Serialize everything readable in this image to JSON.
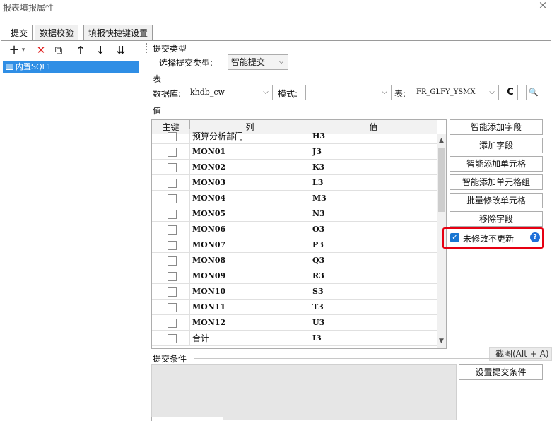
{
  "window": {
    "title": "报表填报属性",
    "close_label": "×"
  },
  "tabs": [
    {
      "label": "提交",
      "active": true
    },
    {
      "label": "数据校验",
      "active": false
    },
    {
      "label": "填报快捷键设置",
      "active": false
    }
  ],
  "toolbar": {
    "add": "+",
    "add_dropdown": "▾",
    "delete": "✕",
    "copy": "⧉",
    "up": "↑",
    "down": "↓",
    "sort": "⇊"
  },
  "tree": {
    "selected_label": "内置SQL1"
  },
  "submit_type": {
    "section_label": "提交类型",
    "field_label": "选择提交类型:",
    "value": "智能提交"
  },
  "table_section": {
    "section_label": "表",
    "db_label": "数据库:",
    "db_value": "khdb_cw",
    "schema_label": "模式:",
    "schema_value": "",
    "table_label": "表:",
    "table_value": "FR_GLFY_YSMX",
    "refresh_icon": "C",
    "preview_icon": "🔍"
  },
  "values": {
    "section_label": "值",
    "headers": {
      "key": "主键",
      "column": "列",
      "value": "值"
    },
    "rows": [
      {
        "column": "预算分析部门",
        "value": "H3",
        "plain": true
      },
      {
        "column": "MON01",
        "value": "J3",
        "plain": false
      },
      {
        "column": "MON02",
        "value": "K3",
        "plain": false
      },
      {
        "column": "MON03",
        "value": "L3",
        "plain": false
      },
      {
        "column": "MON04",
        "value": "M3",
        "plain": false
      },
      {
        "column": "MON05",
        "value": "N3",
        "plain": false
      },
      {
        "column": "MON06",
        "value": "O3",
        "plain": false
      },
      {
        "column": "MON07",
        "value": "P3",
        "plain": false
      },
      {
        "column": "MON08",
        "value": "Q3",
        "plain": false
      },
      {
        "column": "MON09",
        "value": "R3",
        "plain": false
      },
      {
        "column": "MON10",
        "value": "S3",
        "plain": false
      },
      {
        "column": "MON11",
        "value": "T3",
        "plain": false
      },
      {
        "column": "MON12",
        "value": "U3",
        "plain": false
      },
      {
        "column": "合计",
        "value": "I3",
        "plain": true
      }
    ]
  },
  "right_buttons": {
    "smart_add_field": "智能添加字段",
    "add_field": "添加字段",
    "smart_add_cell": "智能添加单元格",
    "smart_add_cell_group": "智能添加单元格组",
    "batch_edit_cell": "批量修改单元格",
    "remove_field": "移除字段",
    "no_update_unmodified": "未修改不更新",
    "checked": true
  },
  "tooltip": {
    "text": "截图(Alt + A)"
  },
  "submit_condition": {
    "section_label": "提交条件",
    "set_button": "设置提交条件"
  },
  "colors": {
    "selection": "#2f8ee5",
    "highlight_border": "#e60012",
    "checkbox": "#1976d2"
  }
}
